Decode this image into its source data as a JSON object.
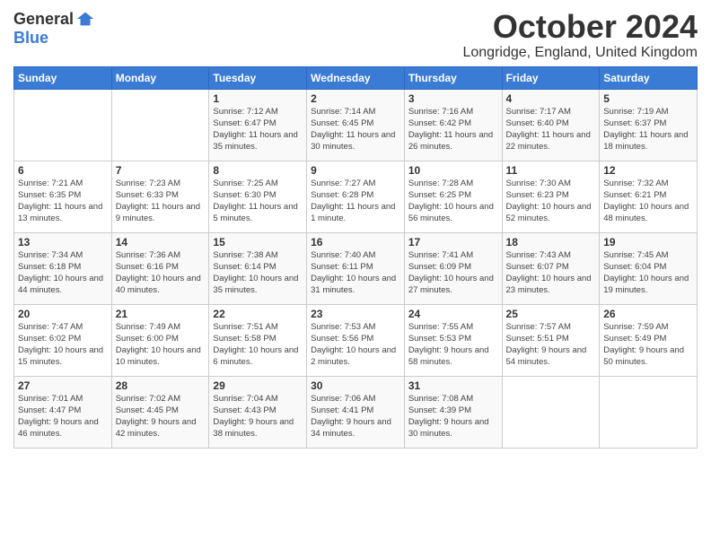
{
  "logo": {
    "general": "General",
    "blue": "Blue"
  },
  "header": {
    "month": "October 2024",
    "location": "Longridge, England, United Kingdom"
  },
  "weekdays": [
    "Sunday",
    "Monday",
    "Tuesday",
    "Wednesday",
    "Thursday",
    "Friday",
    "Saturday"
  ],
  "weeks": [
    [
      {
        "day": null,
        "info": null
      },
      {
        "day": null,
        "info": null
      },
      {
        "day": "1",
        "info": "Sunrise: 7:12 AM\nSunset: 6:47 PM\nDaylight: 11 hours and 35 minutes."
      },
      {
        "day": "2",
        "info": "Sunrise: 7:14 AM\nSunset: 6:45 PM\nDaylight: 11 hours and 30 minutes."
      },
      {
        "day": "3",
        "info": "Sunrise: 7:16 AM\nSunset: 6:42 PM\nDaylight: 11 hours and 26 minutes."
      },
      {
        "day": "4",
        "info": "Sunrise: 7:17 AM\nSunset: 6:40 PM\nDaylight: 11 hours and 22 minutes."
      },
      {
        "day": "5",
        "info": "Sunrise: 7:19 AM\nSunset: 6:37 PM\nDaylight: 11 hours and 18 minutes."
      }
    ],
    [
      {
        "day": "6",
        "info": "Sunrise: 7:21 AM\nSunset: 6:35 PM\nDaylight: 11 hours and 13 minutes."
      },
      {
        "day": "7",
        "info": "Sunrise: 7:23 AM\nSunset: 6:33 PM\nDaylight: 11 hours and 9 minutes."
      },
      {
        "day": "8",
        "info": "Sunrise: 7:25 AM\nSunset: 6:30 PM\nDaylight: 11 hours and 5 minutes."
      },
      {
        "day": "9",
        "info": "Sunrise: 7:27 AM\nSunset: 6:28 PM\nDaylight: 11 hours and 1 minute."
      },
      {
        "day": "10",
        "info": "Sunrise: 7:28 AM\nSunset: 6:25 PM\nDaylight: 10 hours and 56 minutes."
      },
      {
        "day": "11",
        "info": "Sunrise: 7:30 AM\nSunset: 6:23 PM\nDaylight: 10 hours and 52 minutes."
      },
      {
        "day": "12",
        "info": "Sunrise: 7:32 AM\nSunset: 6:21 PM\nDaylight: 10 hours and 48 minutes."
      }
    ],
    [
      {
        "day": "13",
        "info": "Sunrise: 7:34 AM\nSunset: 6:18 PM\nDaylight: 10 hours and 44 minutes."
      },
      {
        "day": "14",
        "info": "Sunrise: 7:36 AM\nSunset: 6:16 PM\nDaylight: 10 hours and 40 minutes."
      },
      {
        "day": "15",
        "info": "Sunrise: 7:38 AM\nSunset: 6:14 PM\nDaylight: 10 hours and 35 minutes."
      },
      {
        "day": "16",
        "info": "Sunrise: 7:40 AM\nSunset: 6:11 PM\nDaylight: 10 hours and 31 minutes."
      },
      {
        "day": "17",
        "info": "Sunrise: 7:41 AM\nSunset: 6:09 PM\nDaylight: 10 hours and 27 minutes."
      },
      {
        "day": "18",
        "info": "Sunrise: 7:43 AM\nSunset: 6:07 PM\nDaylight: 10 hours and 23 minutes."
      },
      {
        "day": "19",
        "info": "Sunrise: 7:45 AM\nSunset: 6:04 PM\nDaylight: 10 hours and 19 minutes."
      }
    ],
    [
      {
        "day": "20",
        "info": "Sunrise: 7:47 AM\nSunset: 6:02 PM\nDaylight: 10 hours and 15 minutes."
      },
      {
        "day": "21",
        "info": "Sunrise: 7:49 AM\nSunset: 6:00 PM\nDaylight: 10 hours and 10 minutes."
      },
      {
        "day": "22",
        "info": "Sunrise: 7:51 AM\nSunset: 5:58 PM\nDaylight: 10 hours and 6 minutes."
      },
      {
        "day": "23",
        "info": "Sunrise: 7:53 AM\nSunset: 5:56 PM\nDaylight: 10 hours and 2 minutes."
      },
      {
        "day": "24",
        "info": "Sunrise: 7:55 AM\nSunset: 5:53 PM\nDaylight: 9 hours and 58 minutes."
      },
      {
        "day": "25",
        "info": "Sunrise: 7:57 AM\nSunset: 5:51 PM\nDaylight: 9 hours and 54 minutes."
      },
      {
        "day": "26",
        "info": "Sunrise: 7:59 AM\nSunset: 5:49 PM\nDaylight: 9 hours and 50 minutes."
      }
    ],
    [
      {
        "day": "27",
        "info": "Sunrise: 7:01 AM\nSunset: 4:47 PM\nDaylight: 9 hours and 46 minutes."
      },
      {
        "day": "28",
        "info": "Sunrise: 7:02 AM\nSunset: 4:45 PM\nDaylight: 9 hours and 42 minutes."
      },
      {
        "day": "29",
        "info": "Sunrise: 7:04 AM\nSunset: 4:43 PM\nDaylight: 9 hours and 38 minutes."
      },
      {
        "day": "30",
        "info": "Sunrise: 7:06 AM\nSunset: 4:41 PM\nDaylight: 9 hours and 34 minutes."
      },
      {
        "day": "31",
        "info": "Sunrise: 7:08 AM\nSunset: 4:39 PM\nDaylight: 9 hours and 30 minutes."
      },
      {
        "day": null,
        "info": null
      },
      {
        "day": null,
        "info": null
      }
    ]
  ]
}
